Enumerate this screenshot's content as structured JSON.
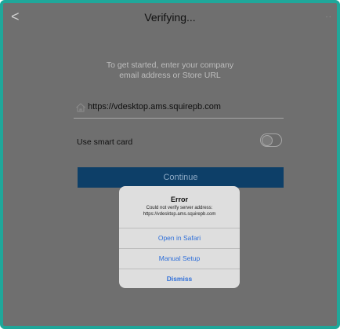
{
  "header": {
    "title": "Verifying...",
    "back_glyph": "<",
    "more_glyph": "··"
  },
  "intro": {
    "line1": "To get started, enter your company",
    "line2": "email address or Store URL"
  },
  "url_field": {
    "value": "https://vdesktop.ams.squirepb.com",
    "icon": "home-icon"
  },
  "smart_card": {
    "label": "Use smart card",
    "enabled": false
  },
  "continue_label": "Continue",
  "dialog": {
    "title": "Error",
    "message_line1": "Could not verify server address:",
    "message_line2": "https://vdesktop.ams.squirepb.com",
    "actions": [
      {
        "label": "Open in Safari"
      },
      {
        "label": "Manual Setup"
      },
      {
        "label": "Dismiss"
      }
    ]
  },
  "colors": {
    "frame": "#1fa79a",
    "background": "#6f6f6f",
    "continue_bg": "#0d3f68",
    "action_text": "#2f6fd9"
  }
}
